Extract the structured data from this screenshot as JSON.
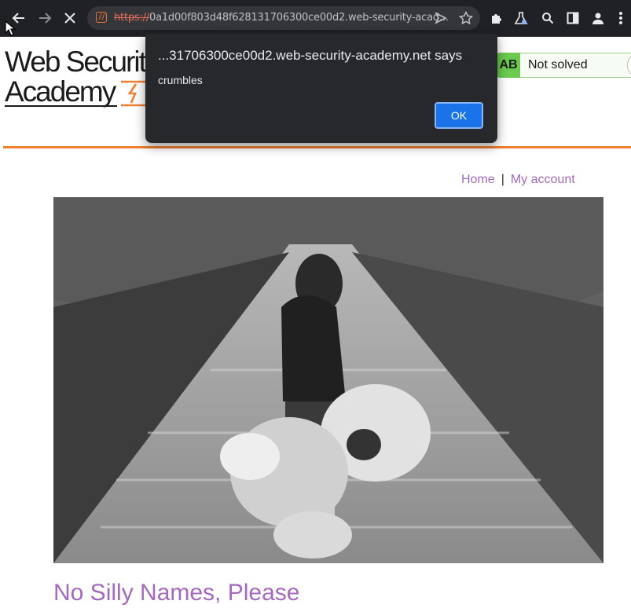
{
  "browser": {
    "url_scheme": "https://",
    "url_rest": "0a1d00f803d48f628131706300ce00d2.web-security-acad...",
    "icons": [
      "back-arrow-icon",
      "forward-arrow-icon",
      "stop-loading-icon",
      "lab-favicon-icon",
      "send-to-device-icon",
      "bookmark-star-icon",
      "extensions-puzzle-icon",
      "lab-flask-icon",
      "search-icon",
      "side-panel-icon",
      "profile-icon",
      "kebab-menu-icon"
    ]
  },
  "logo": {
    "line1": "Web Securit",
    "line2": "Academy"
  },
  "lab_status": {
    "badge": "AB",
    "label": "Not solved",
    "icon": "flask-icon",
    "badge_color": "#6bca4e"
  },
  "nav": {
    "home": "Home",
    "separator": "|",
    "my_account": "My account"
  },
  "post": {
    "title": "No Silly Names, Please"
  },
  "alert": {
    "title": "...31706300ce00d2.web-security-academy.net says",
    "message": "crumbles",
    "ok_label": "OK",
    "ok_color": "#1a73e8"
  },
  "colors": {
    "accent_orange": "#f07f33",
    "link_purple": "#a46ac0"
  }
}
